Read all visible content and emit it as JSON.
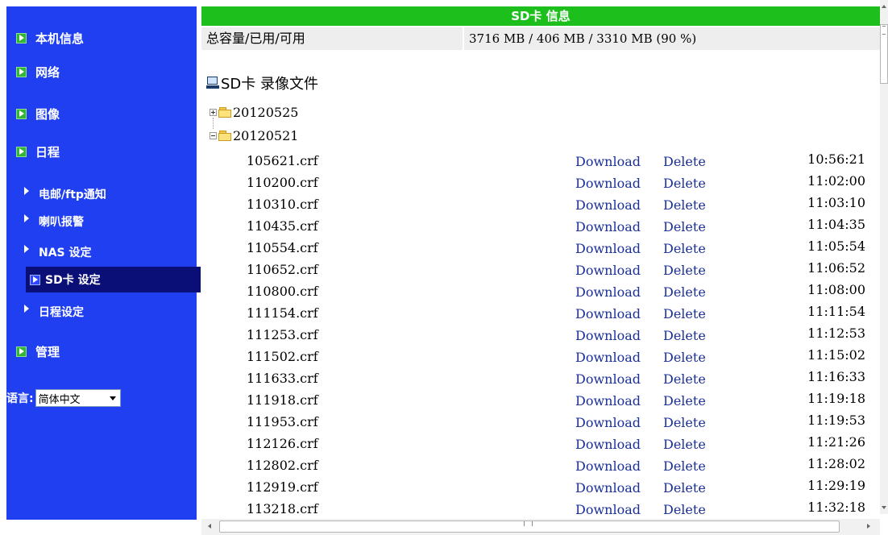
{
  "sidebar": {
    "items": [
      {
        "label": "本机信息"
      },
      {
        "label": "网络"
      },
      {
        "label": "图像"
      },
      {
        "label": "日程"
      }
    ],
    "sub_items": [
      {
        "label": "电邮/ftp通知"
      },
      {
        "label": "喇叭报警"
      },
      {
        "label": "NAS 设定"
      },
      {
        "label": "SD卡 设定",
        "active": true
      },
      {
        "label": "日程设定"
      }
    ],
    "admin": {
      "label": "管理"
    },
    "language": {
      "label": "语言:",
      "value": "简体中文"
    },
    "colors": {
      "background": "#1f3ff0",
      "active": "#0a0f78"
    }
  },
  "main": {
    "header": "SD卡  信息",
    "capacity": {
      "label": "总容量/已用/可用",
      "value": "3716 MB / 406 MB / 3310 MB (90 %)"
    },
    "files_title": "SD卡 录像文件",
    "folders": [
      {
        "name": "20120525",
        "state": "collapsed"
      },
      {
        "name": "20120521",
        "state": "expanded"
      }
    ],
    "actions": {
      "download": "Download",
      "delete": "Delete"
    },
    "files": [
      {
        "name": "105621.crf",
        "time": "10:56:21"
      },
      {
        "name": "110200.crf",
        "time": "11:02:00"
      },
      {
        "name": "110310.crf",
        "time": "11:03:10"
      },
      {
        "name": "110435.crf",
        "time": "11:04:35"
      },
      {
        "name": "110554.crf",
        "time": "11:05:54"
      },
      {
        "name": "110652.crf",
        "time": "11:06:52"
      },
      {
        "name": "110800.crf",
        "time": "11:08:00"
      },
      {
        "name": "111154.crf",
        "time": "11:11:54"
      },
      {
        "name": "111253.crf",
        "time": "11:12:53"
      },
      {
        "name": "111502.crf",
        "time": "11:15:02"
      },
      {
        "name": "111633.crf",
        "time": "11:16:33"
      },
      {
        "name": "111918.crf",
        "time": "11:19:18"
      },
      {
        "name": "111953.crf",
        "time": "11:19:53"
      },
      {
        "name": "112126.crf",
        "time": "11:21:26"
      },
      {
        "name": "112802.crf",
        "time": "11:28:02"
      },
      {
        "name": "112919.crf",
        "time": "11:29:19"
      },
      {
        "name": "113218.crf",
        "time": "11:32:18"
      }
    ],
    "colors": {
      "header": "#1dbf1d",
      "link": "#1a2f9a"
    }
  }
}
